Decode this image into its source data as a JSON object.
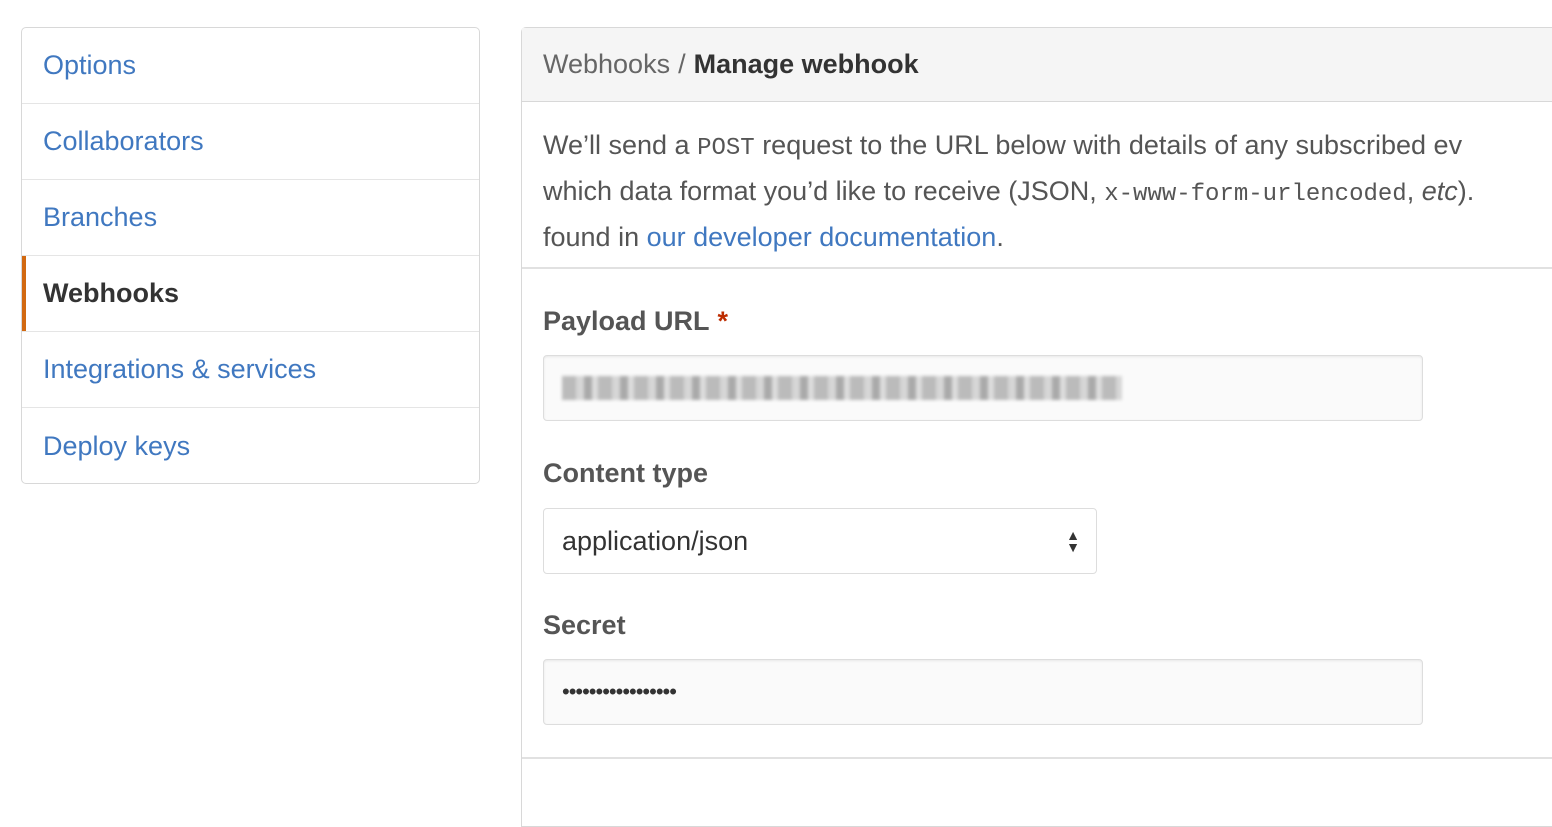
{
  "sidebar": {
    "items": [
      {
        "label": "Options"
      },
      {
        "label": "Collaborators"
      },
      {
        "label": "Branches"
      },
      {
        "label": "Webhooks",
        "selected": true
      },
      {
        "label": "Integrations & services"
      },
      {
        "label": "Deploy keys"
      }
    ]
  },
  "header": {
    "parent": "Webhooks",
    "separator": "/",
    "title": "Manage webhook"
  },
  "description": {
    "l1a": "We’ll send a ",
    "l1code": "POST",
    "l1b": " request to the URL below with details of any subscribed ev",
    "l2a": "which data format you’d like to receive (JSON, ",
    "l2code": "x-www-form-urlencoded",
    "l2b": ", ",
    "l2em": "etc",
    "l2c": ").",
    "l3a": "found in ",
    "link": "our developer documentation",
    "l3b": "."
  },
  "form": {
    "payload_label": "Payload URL",
    "required_mark": "*",
    "content_type_label": "Content type",
    "content_type_value": "application/json",
    "secret_label": "Secret",
    "secret_value": "•••••••••••••••••"
  },
  "colors": {
    "accent": "#d26911",
    "link": "#4078c0",
    "required": "#bd2c00"
  }
}
